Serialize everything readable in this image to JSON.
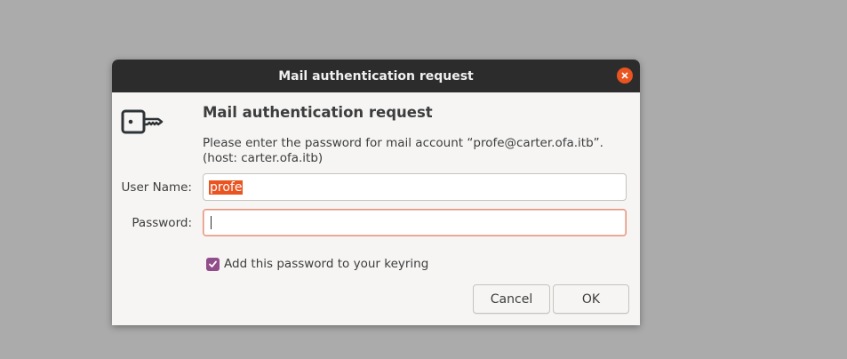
{
  "window": {
    "title": "Mail authentication request"
  },
  "dialog": {
    "heading": "Mail authentication request",
    "message_line1": "Please enter the password for mail account “profe@carter.ofa.itb”.",
    "message_line2": "(host: carter.ofa.itb)",
    "username_label": "User Name:",
    "username_value": "profe",
    "password_label": "Password:",
    "password_value": "",
    "keyring_label": "Add this password to your keyring",
    "keyring_checked": true,
    "cancel_label": "Cancel",
    "ok_label": "OK"
  },
  "icons": {
    "dialog_icon": "key-icon",
    "close": "close-icon",
    "check": "check-icon"
  },
  "colors": {
    "accent": "#e95420",
    "checkbox": "#924d8b",
    "titlebar": "#2c2c2c"
  }
}
